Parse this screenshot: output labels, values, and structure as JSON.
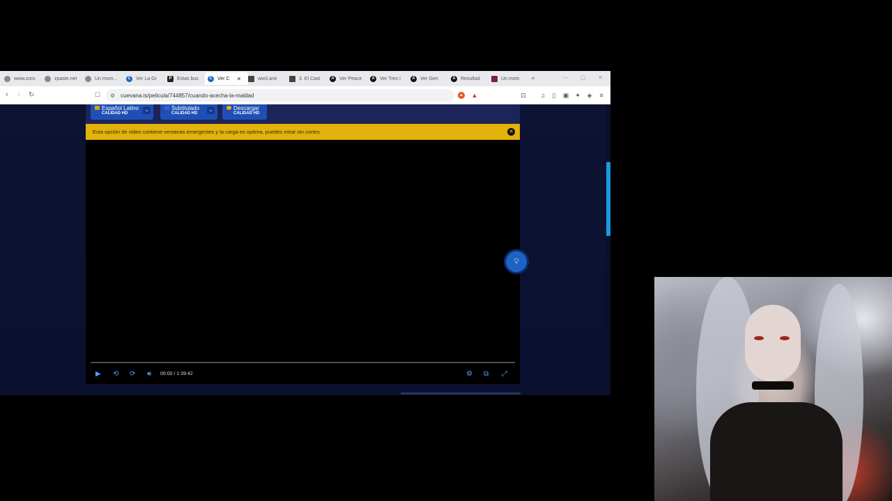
{
  "browser": {
    "tabs": [
      {
        "label": "www.zoro",
        "icon": "globe-icon",
        "color": "#888888"
      },
      {
        "label": "zpaste.net",
        "icon": "globe-icon",
        "color": "#888888"
      },
      {
        "label": "Un mom...",
        "icon": "globe-icon",
        "color": "#888888"
      },
      {
        "label": "Ver La Gr",
        "icon": "cuevana-icon",
        "color": "#1e63c4"
      },
      {
        "label": "Estas bus",
        "icon": "p-icon",
        "color": "#222222"
      },
      {
        "label": "Ver C",
        "icon": "cuevana-icon",
        "color": "#1e63c4",
        "active": true
      },
      {
        "label": "ww3.anir",
        "icon": "image-icon",
        "color": "#444444"
      },
      {
        "label": "3. El Cast",
        "icon": "doc-icon",
        "color": "#444444"
      },
      {
        "label": "Ver Peace",
        "icon": "a-icon",
        "color": "#111111"
      },
      {
        "label": "Ver Tres I",
        "icon": "a-icon",
        "color": "#111111"
      },
      {
        "label": "Ver Gen",
        "icon": "a-icon",
        "color": "#111111"
      },
      {
        "label": "Resultad",
        "icon": "a-icon",
        "color": "#111111"
      },
      {
        "label": "Un mom",
        "icon": "image-icon",
        "color": "#7b1f4a"
      }
    ],
    "new_tab": "+",
    "url": "cuevana.is/pelicula/744857/cuando-acecha-la-maldad"
  },
  "page": {
    "sources": [
      {
        "label": "Español Latino",
        "quality": "CALIDAD HD",
        "flag_color": "#d4a017",
        "has_dropdown": true
      },
      {
        "label": "Subtitulado",
        "quality": "CALIDAD HD",
        "flag_color": "#3b5bd6",
        "has_dropdown": true
      },
      {
        "label": "Descargar",
        "quality": "CALIDAD HD",
        "flag_color": "#e3b20b",
        "has_dropdown": false
      }
    ],
    "notice": "Esta opción de video contiene ventanas emergentes y la carga es optima, puedes mirar sin cortes.",
    "player": {
      "current_time": "00:00",
      "separator": "/",
      "duration": "1:39:42",
      "progress": 0
    }
  },
  "colors": {
    "accent": "#4aa3ff",
    "notice_bg": "#e3b20b",
    "panel_bg": "#1c2459"
  }
}
